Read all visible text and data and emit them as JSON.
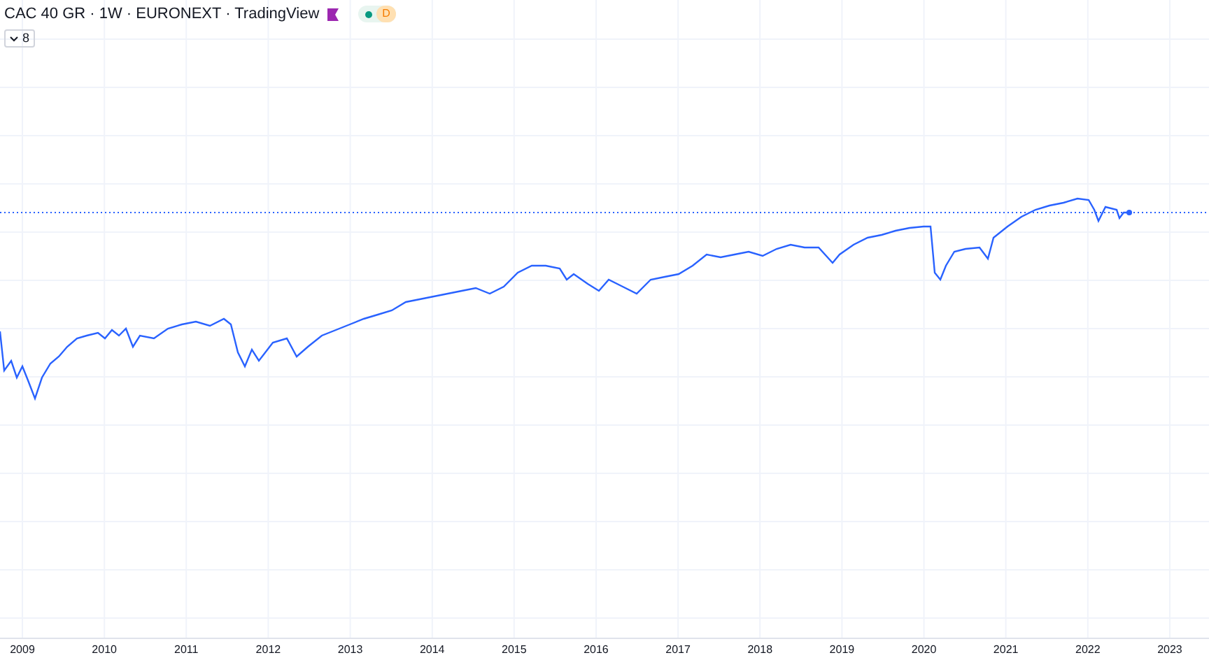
{
  "legend": {
    "title": "CAC 40 GR · 1W · EURONEXT · TradingView",
    "status_badge": "D",
    "indicators_count": "8"
  },
  "x_axis": {
    "labels": [
      "2009",
      "2010",
      "2011",
      "2012",
      "2013",
      "2014",
      "2015",
      "2016",
      "2017",
      "2018",
      "2019",
      "2020",
      "2021",
      "2022",
      "2023"
    ]
  }
}
